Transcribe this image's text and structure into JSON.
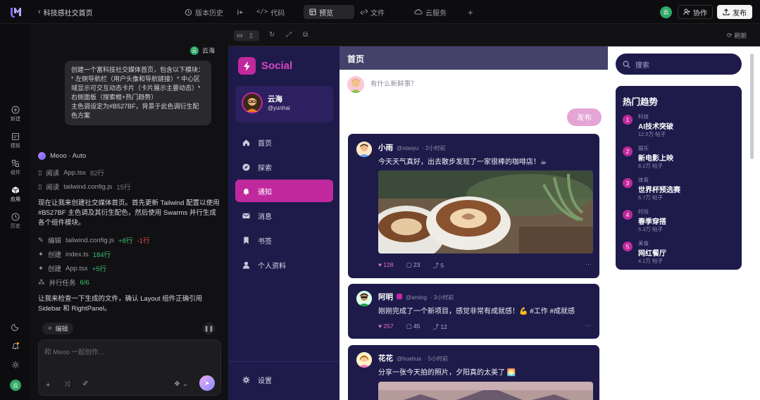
{
  "topbar": {
    "project_title": "科技感社交首页",
    "history_label": "版本历史",
    "code_label": "代码",
    "preview_label": "预览",
    "files_label": "文件",
    "deploy_tab_label": "云服务",
    "user_initial": "云",
    "share_label": "协作",
    "publish_label": "发布"
  },
  "rail": {
    "items": [
      {
        "label": "新建"
      },
      {
        "label": "模板"
      },
      {
        "label": "组件"
      },
      {
        "label": "应用"
      },
      {
        "label": "历史"
      }
    ],
    "avatar_initial": "云"
  },
  "chat": {
    "user_name": "云海",
    "user_initial": "云",
    "user_message": "创建一个富科技社交媒体首页，包含以下模块：\n* 左侧导航栏（用户头像和导航链接）* 中心区域显示可交互动态卡片（卡片展示主要动态）* 右侧面板（搜索框+热门趋势）\n主色调设定为#B527BF，背景于此色调衍生配色方案",
    "agent_name": "Meoo · Auto",
    "read_items": [
      {
        "action": "阅读",
        "file": "App.tsx",
        "count": "82行"
      },
      {
        "action": "阅读",
        "file": "tailwind.config.js",
        "count": "15行"
      }
    ],
    "reply_text": "现在让我来创建社交媒体首页。首先更新 Tailwind 配置以使用 #B527BF 主色调及其衍生配色，然后使用 Swarms 并行生成各个组件模块。",
    "edit_items": [
      {
        "action": "编辑",
        "file": "tailwind.config.js",
        "added": "+8行",
        "removed": "-1行"
      },
      {
        "action": "创建",
        "file": "index.ts",
        "added": "184行",
        "removed": ""
      },
      {
        "action": "创建",
        "file": "App.tsx",
        "added": "+5行",
        "removed": ""
      }
    ],
    "task_label": "并行任务",
    "task_count": "6/6",
    "followup_text": "让我来检查一下生成的文件，确认 Layout 组件正确引用 Sidebar 和 RightPanel。",
    "edit_chip": "编辑",
    "input_placeholder": "和 Meoo 一起创作..."
  },
  "preview_toolbar": {
    "refresh_label": "刷新"
  },
  "social": {
    "brand": "Social",
    "profile_name": "云海",
    "profile_handle": "@yunhai",
    "nav": [
      {
        "label": "首页",
        "icon": "home-icon"
      },
      {
        "label": "探索",
        "icon": "compass-icon"
      },
      {
        "label": "通知",
        "icon": "bell-icon"
      },
      {
        "label": "消息",
        "icon": "mail-icon"
      },
      {
        "label": "书签",
        "icon": "bookmark-icon"
      },
      {
        "label": "个人资料",
        "icon": "user-icon"
      }
    ],
    "settings_label": "设置",
    "feed_title": "首页",
    "composer_placeholder": "有什么新鲜事？",
    "publish_button": "发布",
    "posts": [
      {
        "name": "小雨",
        "handle": "@xiaoyu",
        "time": "· 2小时前",
        "text": "今天天气真好，出去散步发现了一家很棒的咖啡店！☕",
        "likes": "128",
        "comments": "23",
        "shares": "5"
      },
      {
        "name": "阿明",
        "handle": "@aming",
        "time": "· 3小时前",
        "text": "刚刚完成了一个新项目，感觉非常有成就感！💪 #工作 #成就感",
        "likes": "257",
        "comments": "45",
        "shares": "12"
      },
      {
        "name": "花花",
        "handle": "@huahua",
        "time": "· 5小时前",
        "text": "分享一张今天拍的照片，夕阳真的太美了 🌅",
        "likes": "",
        "comments": "",
        "shares": ""
      }
    ],
    "search_placeholder": "搜索",
    "trends_title": "热门趋势",
    "trends": [
      {
        "rank": "1",
        "category": "科技",
        "topic": "AI技术突破",
        "count": "12.5万 帖子"
      },
      {
        "rank": "2",
        "category": "娱乐",
        "topic": "新电影上映",
        "count": "8.2万 帖子"
      },
      {
        "rank": "3",
        "category": "体育",
        "topic": "世界杯预选赛",
        "count": "6.7万 帖子"
      },
      {
        "rank": "4",
        "category": "时尚",
        "topic": "春季穿搭",
        "count": "5.3万 帖子"
      },
      {
        "rank": "5",
        "category": "美食",
        "topic": "网红餐厅",
        "count": "4.1万 帖子"
      }
    ]
  },
  "colors": {
    "accent": "#B527BF",
    "nav_bg": "#1E1B4B",
    "active_nav": "#C0299D"
  }
}
